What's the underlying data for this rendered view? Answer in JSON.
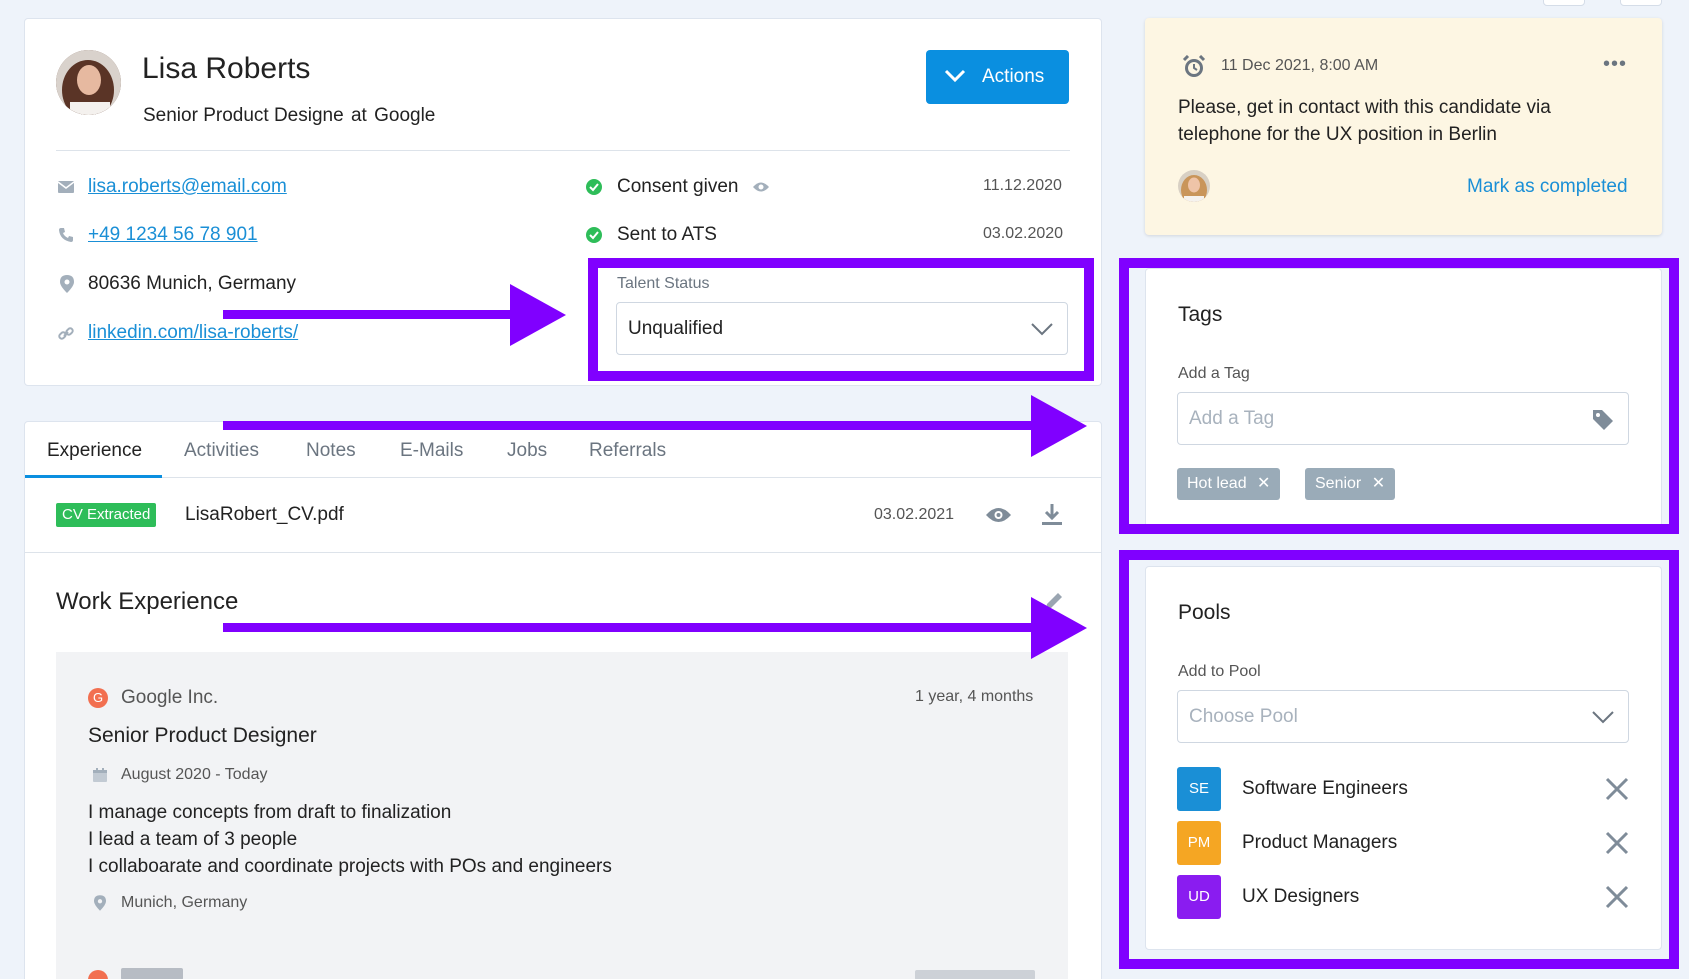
{
  "profile": {
    "name": "Lisa Roberts",
    "role": "Senior Product Designe",
    "at": "at",
    "company": "Google",
    "actions_label": "Actions"
  },
  "contact": {
    "email": "lisa.roberts@email.com",
    "phone": "+49 1234 56 78 901",
    "location": "80636 Munich, Germany",
    "linkedin": "linkedin.com/lisa-roberts/"
  },
  "status_items": [
    {
      "label": "Consent given",
      "date": "11.12.2020"
    },
    {
      "label": "Sent to ATS",
      "date": "03.02.2020"
    }
  ],
  "talent_status": {
    "label": "Talent Status",
    "value": "Unqualified"
  },
  "tabs": [
    "Experience",
    "Activities",
    "Notes",
    "E-Mails",
    "Jobs",
    "Referrals"
  ],
  "cv": {
    "badge": "CV Extracted",
    "filename": "LisaRobert_CV.pdf",
    "date": "03.02.2021"
  },
  "work": {
    "title": "Work Experience",
    "entries": [
      {
        "company_initial": "G",
        "company": "Google Inc.",
        "duration": "1 year, 4 months",
        "position": "Senior Product Designer",
        "period": "August 2020 - Today",
        "lines": [
          "I manage concepts from draft to finalization",
          "I lead a team of 3 people",
          "I collaboarate and coordinate projects with POs and engineers"
        ],
        "location": "Munich, Germany"
      }
    ]
  },
  "reminder": {
    "datetime": "11 Dec 2021, 8:00 AM",
    "text_line1": "Please, get in contact with this candidate via",
    "text_line2": "telephone for the UX position in Berlin",
    "complete_label": "Mark as completed"
  },
  "tags": {
    "title": "Tags",
    "field_label": "Add a Tag",
    "placeholder": "Add a Tag",
    "items": [
      "Hot lead",
      "Senior"
    ]
  },
  "pools": {
    "title": "Pools",
    "field_label": "Add to Pool",
    "placeholder": "Choose Pool",
    "items": [
      {
        "abbr": "SE",
        "name": "Software Engineers",
        "color": "#1a8fd6"
      },
      {
        "abbr": "PM",
        "name": "Product Managers",
        "color": "#f5a623"
      },
      {
        "abbr": "UD",
        "name": "UX Designers",
        "color": "#8a1cf0"
      }
    ]
  },
  "colors": {
    "accent": "#0a8fe0",
    "annotation": "#8000ff",
    "success": "#2ebd59",
    "reminder_bg": "#fdf6e3"
  }
}
